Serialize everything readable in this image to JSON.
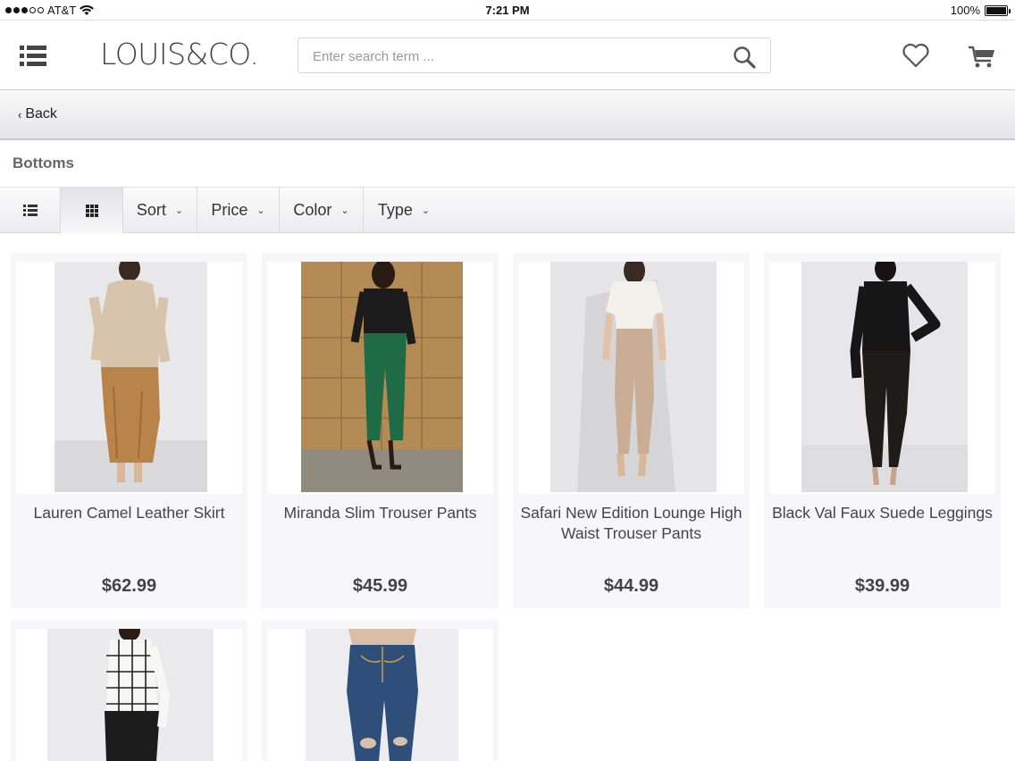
{
  "status_bar": {
    "carrier": "AT&T",
    "time": "7:21 PM",
    "battery": "100%"
  },
  "header": {
    "logo": "LOUIS&CO.",
    "search_placeholder": "Enter search term ..."
  },
  "nav": {
    "back_label": "Back"
  },
  "category": {
    "title": "Bottoms"
  },
  "toolbar": {
    "sort_label": "Sort",
    "price_label": "Price",
    "color_label": "Color",
    "type_label": "Type"
  },
  "products": [
    {
      "name": "Lauren Camel Leather Skirt",
      "price": "$62.99"
    },
    {
      "name": "Miranda Slim Trouser Pants",
      "price": "$45.99"
    },
    {
      "name": "Safari New Edition Lounge High Waist Trouser Pants",
      "price": "$44.99"
    },
    {
      "name": "Black Val Faux Suede Leggings",
      "price": "$39.99"
    },
    {
      "name": "",
      "price": ""
    },
    {
      "name": "",
      "price": ""
    }
  ],
  "colors": {
    "accent_text": "#444444",
    "toolbar_bg": "#ececef"
  }
}
